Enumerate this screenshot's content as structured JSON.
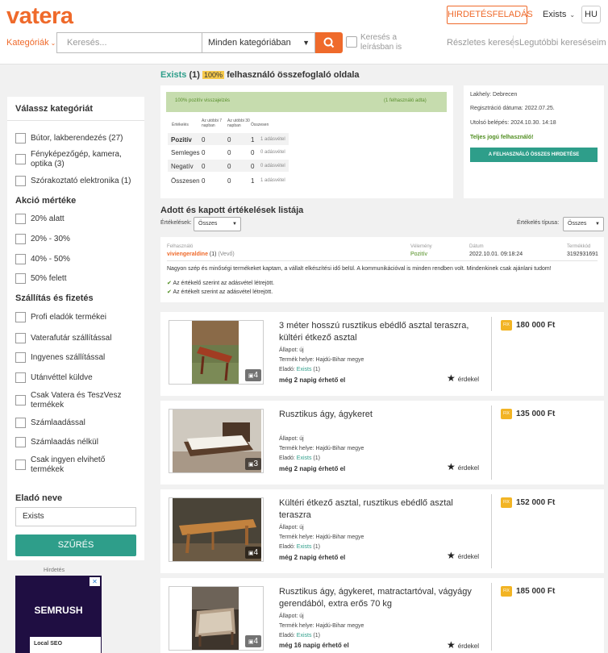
{
  "header": {
    "logo": "vatera",
    "post_ad": "HIRDETÉSFELADÁS",
    "user": "Exists",
    "lang": "HU",
    "categories_label": "Kategóriák",
    "search_placeholder": "Keresés...",
    "category_select": "Minden kategóriában",
    "search_desc_label": "Keresés a leírásban is",
    "advanced_search": "Részletes keresés",
    "recent_searches": "Legutóbbi kereséseim"
  },
  "sidebar": {
    "category_title": "Válassz kategóriát",
    "categories": [
      "Bútor, lakberendezés (27)",
      "Fényképezőgép, kamera, optika (3)",
      "Szórakoztató elektronika (1)"
    ],
    "discount_title": "Akció mértéke",
    "discounts": [
      "20% alatt",
      "20% - 30%",
      "40% - 50%",
      "50% felett"
    ],
    "shipping_title": "Szállítás és fizetés",
    "shipping": [
      "Profi eladók termékei",
      "Vaterafutár szállítással",
      "Ingyenes szállítással",
      "Utánvéttel küldve",
      "Csak Vatera és TeszVesz termékek",
      "Számlaadással",
      "Számlaadás nélkül",
      "Csak ingyen elvihető termékek"
    ],
    "seller_title": "Eladó neve",
    "seller_value": "Exists",
    "filter_button": "SZŰRÉS",
    "ad_label": "Hirdetés",
    "ad_brand": "SEMRUSH",
    "ad_text": "Local SEO"
  },
  "summary": {
    "title_user": "Exists",
    "title_count": "(1)",
    "title_badge": "100%",
    "title_rest": "felhasználó összefoglaló oldala",
    "positive_bar": "100% pozitív visszajelzés",
    "rated_by": "(1 felhasználó adta)",
    "col_headers": [
      "Értékelés",
      "Az utóbbi 7 napban",
      "Az utóbbi 30 napban",
      "Összesen"
    ],
    "rows": [
      {
        "label": "Pozitív",
        "d7": "0",
        "d30": "0",
        "total": "1",
        "link": "1 adásvétel"
      },
      {
        "label": "Semleges",
        "d7": "0",
        "d30": "0",
        "total": "0",
        "link": "0 adásvétel"
      },
      {
        "label": "Negatív",
        "d7": "0",
        "d30": "0",
        "total": "0",
        "link": "0 adásvétel"
      },
      {
        "label": "Összesen",
        "d7": "0",
        "d30": "0",
        "total": "1",
        "link": "1 adásvétel"
      }
    ],
    "location_label": "Lakhely:",
    "location": "Debrecen",
    "reg_label": "Regisztráció dátuma:",
    "reg_date": "2022.07.25.",
    "last_label": "Utolsó belépés:",
    "last_login": "2024.10.30. 14:18",
    "rights": "Teljes jogú felhasználó!",
    "all_ads_button": "A FELHASZNÁLÓ ÖSSZES HIRDETÉSE"
  },
  "reviews": {
    "title": "Adott és kapott értékelések listája",
    "filter_label": "Értékelések:",
    "filter_value": "Összes",
    "type_label": "Értékelés típusa:",
    "type_value": "Összes",
    "item": {
      "user_label": "Felhasználó",
      "user": "viviengeraldine",
      "user_count": "(1)",
      "user_role": "(Vevő)",
      "rating_label": "Vélemény",
      "rating": "Pozitív",
      "date_label": "Dátum",
      "date": "2022.10.01. 09:18:24",
      "product_label": "Termékkód",
      "product": "3192931691",
      "text": "Nagyon szép és minőségi termékeket kaptam, a vállalt elkészítési idő belül. A kommunikációval is minden rendben volt. Mindenkinek csak ajánlani tudom!",
      "check1": "Az értékelő szerint az adásvétel létrejött.",
      "check2": "Az értékelt szerint az adásvétel létrejött."
    }
  },
  "listings": [
    {
      "title": "3 méter hosszú rusztikus ebédlő asztal teraszra, kültéri étkező asztal",
      "state": "Állapot: új",
      "location": "Termék helye: Hajdú-Bihar megye",
      "seller": "Eladó: ",
      "seller_name": "Exists",
      "seller_count": " (1)",
      "avail": "még 2 napig érhető el",
      "watch": "érdekel",
      "fix": "FIX",
      "price": "180 000 Ft",
      "photos": "4"
    },
    {
      "title": "Rusztikus ágy, ágykeret",
      "state": "Állapot: új",
      "location": "Termék helye: Hajdú-Bihar megye",
      "seller": "Eladó: ",
      "seller_name": "Exists",
      "seller_count": " (1)",
      "avail": "még 2 napig érhető el",
      "watch": "érdekel",
      "fix": "FIX",
      "price": "135 000 Ft",
      "photos": "3"
    },
    {
      "title": "Kültéri étkező asztal, rusztikus ebédlő asztal teraszra",
      "state": "Állapot: új",
      "location": "Termék helye: Hajdú-Bihar megye",
      "seller": "Eladó: ",
      "seller_name": "Exists",
      "seller_count": " (1)",
      "avail": "még 2 napig érhető el",
      "watch": "érdekel",
      "fix": "FIX",
      "price": "152 000 Ft",
      "photos": "4"
    },
    {
      "title": "Rusztikus ágy, ágykeret, matractartóval, vágyágy gerendából, extra erős 70 kg",
      "state": "Állapot: új",
      "location": "Termék helye: Hajdú-Bihar megye",
      "seller": "Eladó: ",
      "seller_name": "Exists",
      "seller_count": " (1)",
      "avail": "még 16 napig érhető el",
      "watch": "érdekel",
      "fix": "FIX",
      "price": "185 000 Ft",
      "photos": "4"
    }
  ]
}
